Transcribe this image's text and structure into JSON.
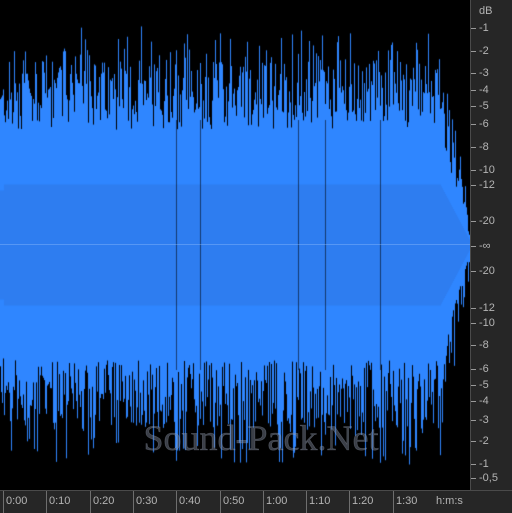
{
  "waveform": {
    "color": "#2f86ff",
    "background": "#000000",
    "watermark": "Sound-Pack.Net"
  },
  "db_ruler": {
    "unit": "dB",
    "labels": [
      "-1",
      "-2",
      "-3",
      "-4",
      "-5",
      "-6",
      "-8",
      "-10",
      "-12",
      "-20",
      "-∞",
      "-20",
      "-12",
      "-10",
      "-8",
      "-6",
      "-5",
      "-4",
      "-3",
      "-2",
      "-1",
      "-0,5"
    ]
  },
  "time_ruler": {
    "labels": [
      "0:00",
      "0:10",
      "0:20",
      "0:30",
      "0:40",
      "0:50",
      "1:00",
      "1:10",
      "1:20",
      "1:30"
    ],
    "unit": "h:m:s"
  }
}
